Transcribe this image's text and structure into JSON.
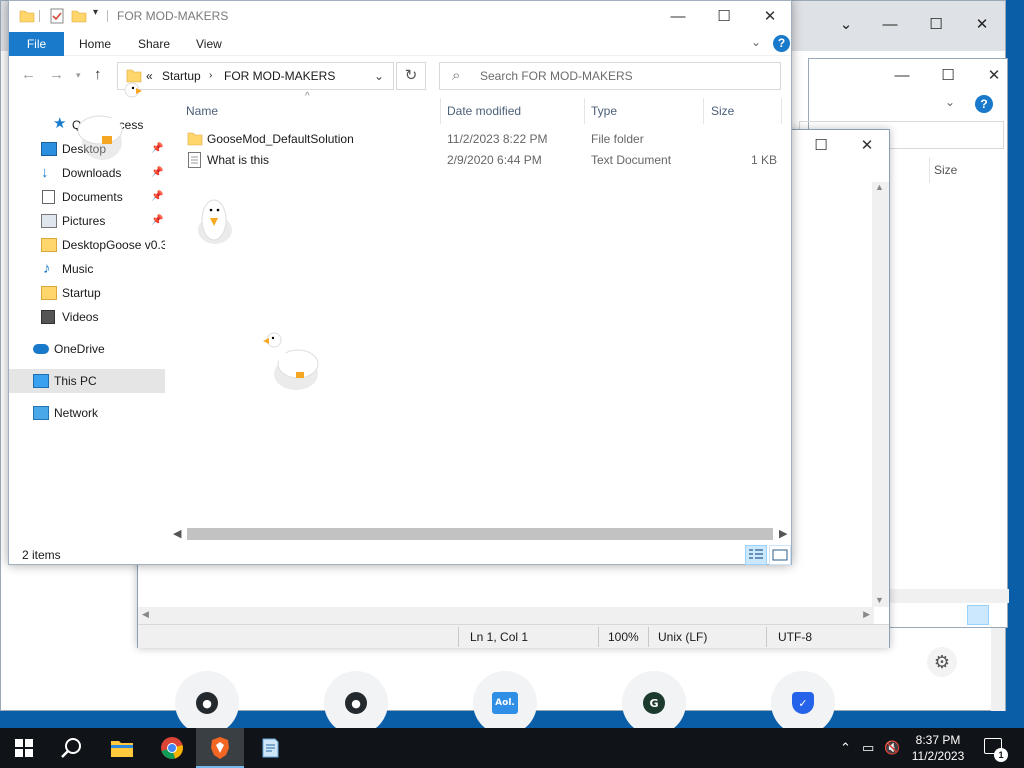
{
  "explorer": {
    "title": "FOR MOD-MAKERS",
    "ribbon_tabs": [
      "File",
      "Home",
      "Share",
      "View"
    ],
    "address": {
      "prefix": "«",
      "crumbs": [
        "Startup",
        "FOR MOD-MAKERS"
      ]
    },
    "search_placeholder": "Search FOR MOD-MAKERS",
    "nav_items": [
      {
        "label": "Quick access",
        "icon": "star-icon"
      },
      {
        "label": "Desktop",
        "icon": "desktop-icon",
        "pinned": true
      },
      {
        "label": "Downloads",
        "icon": "download-icon",
        "pinned": true
      },
      {
        "label": "Documents",
        "icon": "documents-icon",
        "pinned": true
      },
      {
        "label": "Pictures",
        "icon": "pictures-icon",
        "pinned": true
      },
      {
        "label": "DesktopGoose v0.31",
        "icon": "folder-icon"
      },
      {
        "label": "Music",
        "icon": "music-icon"
      },
      {
        "label": "Startup",
        "icon": "folder-icon"
      },
      {
        "label": "Videos",
        "icon": "videos-icon"
      },
      {
        "label": "OneDrive",
        "icon": "cloud-icon"
      },
      {
        "label": "This PC",
        "icon": "pc-icon",
        "selected": true
      },
      {
        "label": "Network",
        "icon": "network-icon"
      }
    ],
    "columns": {
      "name": "Name",
      "date": "Date modified",
      "type": "Type",
      "size": "Size"
    },
    "files": [
      {
        "name": "GooseMod_DefaultSolution",
        "date": "11/2/2023 8:22 PM",
        "type": "File folder",
        "size": ""
      },
      {
        "name": "What is this",
        "date": "2/9/2020 6:44 PM",
        "type": "Text Document",
        "size": "1 KB"
      }
    ],
    "status_count": "2 items"
  },
  "notepad": {
    "status": {
      "position": "Ln 1, Col 1",
      "zoom": "100%",
      "eol": "Unix (LF)",
      "encoding": "UTF-8"
    }
  },
  "explorer_back": {
    "column_size": "Size"
  },
  "browser": {
    "speed_dial": [
      {
        "name": "github-icon"
      },
      {
        "name": "github-icon"
      },
      {
        "name": "aol-icon",
        "label": "Aol."
      },
      {
        "name": "g-icon",
        "label": "G"
      },
      {
        "name": "shield-check-icon"
      }
    ]
  },
  "taskbar": {
    "time": "8:37 PM",
    "date": "11/2/2023",
    "notification_count": "1",
    "apps": [
      "start-icon",
      "search-icon",
      "file-explorer-icon",
      "chrome-icon",
      "brave-icon",
      "notepad-icon"
    ]
  },
  "colors": {
    "accent": "#1979ca",
    "taskbar": "#101418",
    "folder": "#ffd66b"
  }
}
